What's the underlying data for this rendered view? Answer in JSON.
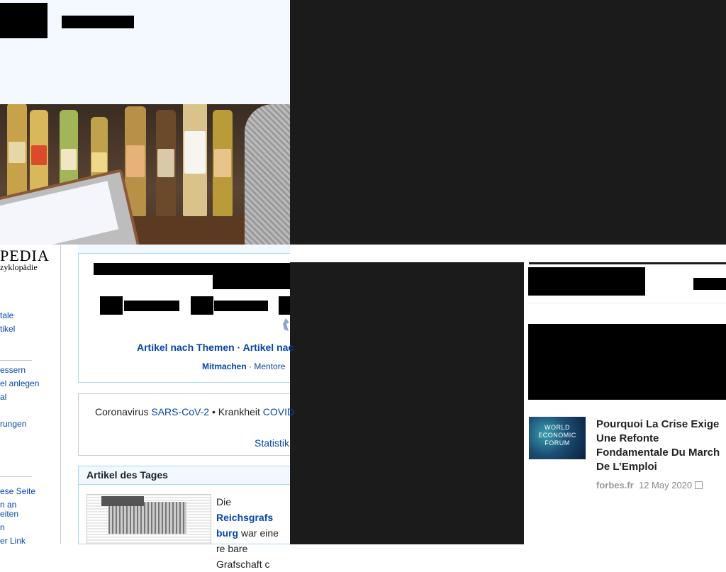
{
  "wikipedia": {
    "logo_text": "PEDIA",
    "tagline": "zyklopädie",
    "sidebar": {
      "items": [
        "tale",
        "tikel",
        "essern",
        "el anlegen",
        "al",
        "rungen",
        "ese Seite",
        "n an",
        "eiten",
        "n",
        "er Link"
      ]
    },
    "portal": {
      "nav_links": "Artikel nach Themen · Artikel nac",
      "nav_links2_bold": "Mitmachen",
      "nav_links2_rest": " · Mentore"
    },
    "corona": {
      "prefix": "Coronavirus ",
      "virus": "SARS-CoV-2",
      "middle": " • Krankheit ",
      "disease": "COVID",
      "statistik": "Statistik"
    },
    "artikel_des_tages": {
      "heading": "Artikel des Tages",
      "text_start": "Die ",
      "link_text": "Reichsgrafs burg",
      "text_rest": " war eine re bare Grafschaft c"
    }
  },
  "news": {
    "thumb_label": "WORLD ECONOMIC FORUM",
    "title": "Pourquoi La Crise Exige Une Refonte Fondamentale Du March De L’Emploi",
    "source": "forbes.fr",
    "date": "12 May 2020"
  },
  "colors": {
    "link": "#0645ad",
    "dark_panel": "#1c1b1c",
    "wiki_box_border": "#a7d7f9",
    "wiki_box_fill": "#f1f8ff"
  }
}
